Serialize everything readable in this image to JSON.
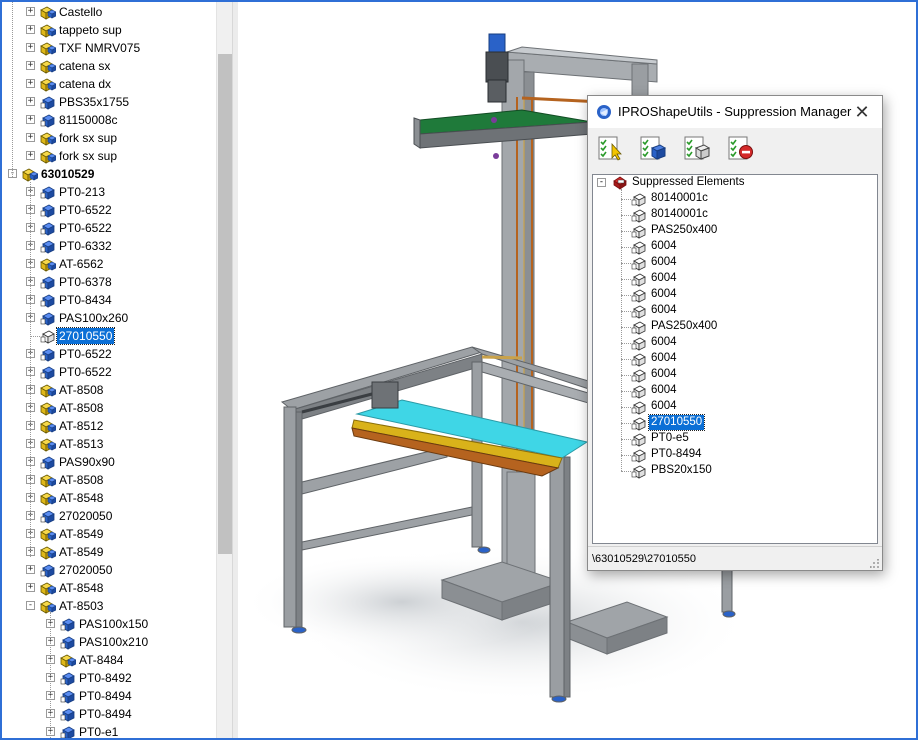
{
  "left_tree": {
    "rows": [
      {
        "label": "Castello",
        "icon": "subassembly-yellow-icon",
        "level": 1,
        "expander": "+"
      },
      {
        "label": "tappeto sup",
        "icon": "subassembly-yellow-icon",
        "level": 1,
        "expander": "+"
      },
      {
        "label": "TXF NMRV075",
        "icon": "subassembly-yellow-icon",
        "level": 1,
        "expander": "+"
      },
      {
        "label": "catena sx",
        "icon": "subassembly-yellow-icon",
        "level": 1,
        "expander": "+"
      },
      {
        "label": "catena dx",
        "icon": "subassembly-yellow-icon",
        "level": 1,
        "expander": "+"
      },
      {
        "label": "PBS35x1755",
        "icon": "part-blue-icon",
        "level": 1,
        "expander": "+"
      },
      {
        "label": "81150008c",
        "icon": "part-blue-icon",
        "level": 1,
        "expander": "+"
      },
      {
        "label": "fork sx sup",
        "icon": "subassembly-yellow-icon",
        "level": 1,
        "expander": "+"
      },
      {
        "label": "fork sx sup",
        "icon": "subassembly-yellow-icon",
        "level": 1,
        "expander": "+"
      },
      {
        "label": "63010529",
        "icon": "assembly-yellow-icon",
        "level": 0,
        "expander": "-",
        "bold": true
      },
      {
        "label": "PT0-213",
        "icon": "part-blue-icon",
        "level": 1,
        "expander": "+"
      },
      {
        "label": "PT0-6522",
        "icon": "part-blue-icon",
        "level": 1,
        "expander": "+"
      },
      {
        "label": "PT0-6522",
        "icon": "part-blue-icon",
        "level": 1,
        "expander": "+"
      },
      {
        "label": "PT0-6332",
        "icon": "part-blue-icon",
        "level": 1,
        "expander": "+"
      },
      {
        "label": "AT-6562",
        "icon": "subassembly-yellow-icon",
        "level": 1,
        "expander": "+"
      },
      {
        "label": "PT0-6378",
        "icon": "part-blue-icon",
        "level": 1,
        "expander": "+"
      },
      {
        "label": "PT0-8434",
        "icon": "part-blue-icon",
        "level": 1,
        "expander": "+"
      },
      {
        "label": "PAS100x260",
        "icon": "part-blue-icon",
        "level": 1,
        "expander": "+"
      },
      {
        "label": "27010550",
        "icon": "suppressed-part-icon",
        "level": 1,
        "expander": "",
        "selected": true
      },
      {
        "label": "PT0-6522",
        "icon": "part-blue-icon",
        "level": 1,
        "expander": "+"
      },
      {
        "label": "PT0-6522",
        "icon": "part-blue-icon",
        "level": 1,
        "expander": "+"
      },
      {
        "label": "AT-8508",
        "icon": "subassembly-yellow-icon",
        "level": 1,
        "expander": "+"
      },
      {
        "label": "AT-8508",
        "icon": "subassembly-yellow-icon",
        "level": 1,
        "expander": "+"
      },
      {
        "label": "AT-8512",
        "icon": "subassembly-yellow-icon",
        "level": 1,
        "expander": "+"
      },
      {
        "label": "AT-8513",
        "icon": "subassembly-yellow-icon",
        "level": 1,
        "expander": "+"
      },
      {
        "label": "PAS90x90",
        "icon": "part-blue-icon",
        "level": 1,
        "expander": "+"
      },
      {
        "label": "AT-8508",
        "icon": "subassembly-yellow-icon",
        "level": 1,
        "expander": "+"
      },
      {
        "label": "AT-8548",
        "icon": "subassembly-yellow-icon",
        "level": 1,
        "expander": "+"
      },
      {
        "label": "27020050",
        "icon": "part-blue-icon",
        "level": 1,
        "expander": "+"
      },
      {
        "label": "AT-8549",
        "icon": "subassembly-yellow-icon",
        "level": 1,
        "expander": "+"
      },
      {
        "label": "AT-8549",
        "icon": "subassembly-yellow-icon",
        "level": 1,
        "expander": "+"
      },
      {
        "label": "27020050",
        "icon": "part-blue-icon",
        "level": 1,
        "expander": "+"
      },
      {
        "label": "AT-8548",
        "icon": "subassembly-yellow-icon",
        "level": 1,
        "expander": "+"
      },
      {
        "label": "AT-8503",
        "icon": "subassembly-yellow-icon",
        "level": 1,
        "expander": "-"
      },
      {
        "label": "PAS100x150",
        "icon": "part-blue-icon",
        "level": 2,
        "expander": "+"
      },
      {
        "label": "PAS100x210",
        "icon": "part-blue-icon",
        "level": 2,
        "expander": "+"
      },
      {
        "label": "AT-8484",
        "icon": "subassembly-yellow-icon",
        "level": 2,
        "expander": "+"
      },
      {
        "label": "PT0-8492",
        "icon": "part-blue-icon",
        "level": 2,
        "expander": "+"
      },
      {
        "label": "PT0-8494",
        "icon": "part-blue-icon",
        "level": 2,
        "expander": "+"
      },
      {
        "label": "PT0-8494",
        "icon": "part-blue-icon",
        "level": 2,
        "expander": "+"
      },
      {
        "label": "PT0-e1",
        "icon": "part-blue-icon",
        "level": 2,
        "expander": "+"
      }
    ]
  },
  "dialog": {
    "title": "IPROShapeUtils - Suppression Manager",
    "close_glyph": "✕",
    "toolbar": [
      {
        "name": "select-suppressed-button",
        "icon": "checklist-cursor-icon"
      },
      {
        "name": "suppress-button",
        "icon": "checklist-part-icon"
      },
      {
        "name": "unsuppress-button",
        "icon": "checklist-part-outline-icon"
      },
      {
        "name": "remove-button",
        "icon": "checklist-stop-icon"
      }
    ],
    "tree": {
      "root_label": "Suppressed Elements",
      "root_expander": "-",
      "items": [
        {
          "label": "80140001c"
        },
        {
          "label": "80140001c"
        },
        {
          "label": "PAS250x400"
        },
        {
          "label": "6004"
        },
        {
          "label": "6004"
        },
        {
          "label": "6004"
        },
        {
          "label": "6004"
        },
        {
          "label": "6004"
        },
        {
          "label": "PAS250x400"
        },
        {
          "label": "6004"
        },
        {
          "label": "6004"
        },
        {
          "label": "6004"
        },
        {
          "label": "6004"
        },
        {
          "label": "6004"
        },
        {
          "label": "27010550",
          "selected": true
        },
        {
          "label": "PT0-e5"
        },
        {
          "label": "PT0-8494"
        },
        {
          "label": "PBS20x150"
        }
      ]
    },
    "status_path": "\\63010529\\27010550"
  },
  "colors": {
    "selection": "#0b6fd6",
    "window_border": "#2f6fd6",
    "frame_gray": "#8e9296",
    "conveyor_green": "#1f7a3a",
    "conveyor_yellow": "#d9b21a",
    "conveyor_cyan": "#3fd6e6",
    "motor_blue": "#2a62c8"
  }
}
